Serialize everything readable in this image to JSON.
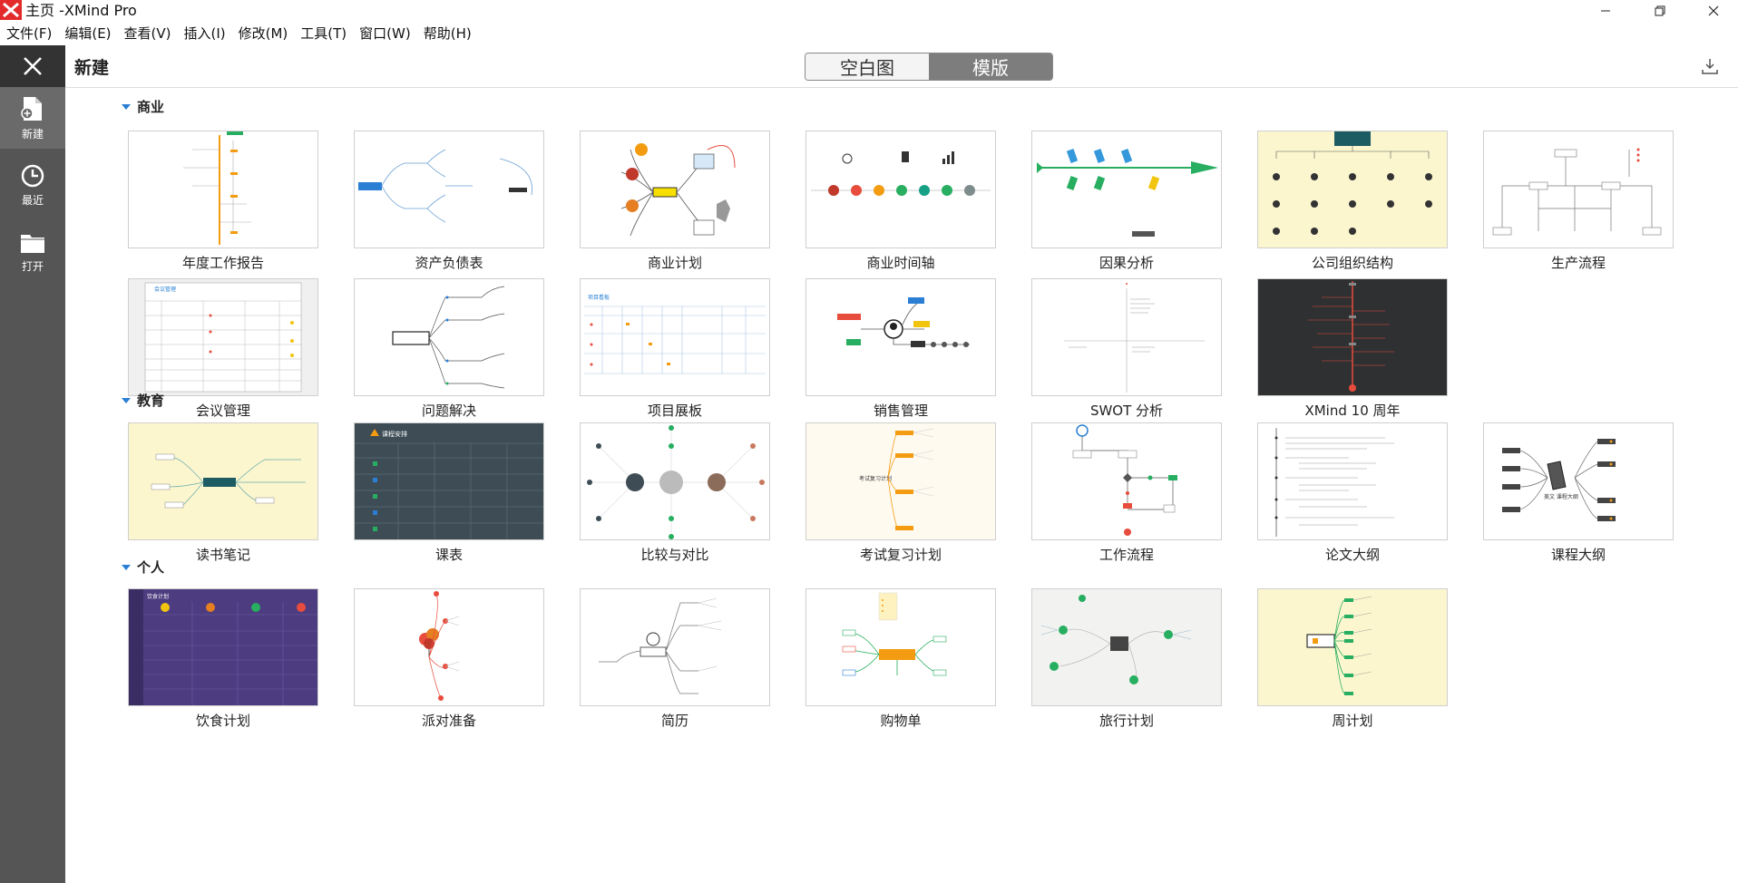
{
  "window": {
    "title": "主页 -XMind Pro",
    "controls": [
      "minimize-icon",
      "restore-icon",
      "close-icon"
    ]
  },
  "menu": [
    "文件(F)",
    "编辑(E)",
    "查看(V)",
    "插入(I)",
    "修改(M)",
    "工具(T)",
    "窗口(W)",
    "帮助(H)"
  ],
  "sidebar": {
    "items": [
      {
        "label": "新建",
        "icon": "new-file-icon"
      },
      {
        "label": "最近",
        "icon": "clock-icon"
      },
      {
        "label": "打开",
        "icon": "folder-icon"
      }
    ]
  },
  "header": {
    "title": "新建",
    "tabs": [
      "空白图",
      "模版"
    ],
    "active_tab": "模版"
  },
  "sections": [
    {
      "title": "商业",
      "cards": [
        "年度工作报告",
        "资产负债表",
        "商业计划",
        "商业时间轴",
        "因果分析",
        "公司组织结构",
        "生产流程",
        "会议管理",
        "问题解决",
        "项目展板",
        "销售管理",
        "SWOT 分析",
        "XMind 10 周年"
      ]
    },
    {
      "title": "教育",
      "cards": [
        "读书笔记",
        "课表",
        "比较与对比",
        "考试复习计划",
        "工作流程",
        "论文大纲",
        "课程大纲"
      ]
    },
    {
      "title": "个人",
      "cards": [
        "饮食计划",
        "派对准备",
        "简历",
        "购物单",
        "旅行计划",
        "周计划"
      ]
    }
  ],
  "colors": {
    "sidebar_bg": "#555555",
    "accent_red": "#e32b2b",
    "section_arrow": "#2a7fd4"
  }
}
